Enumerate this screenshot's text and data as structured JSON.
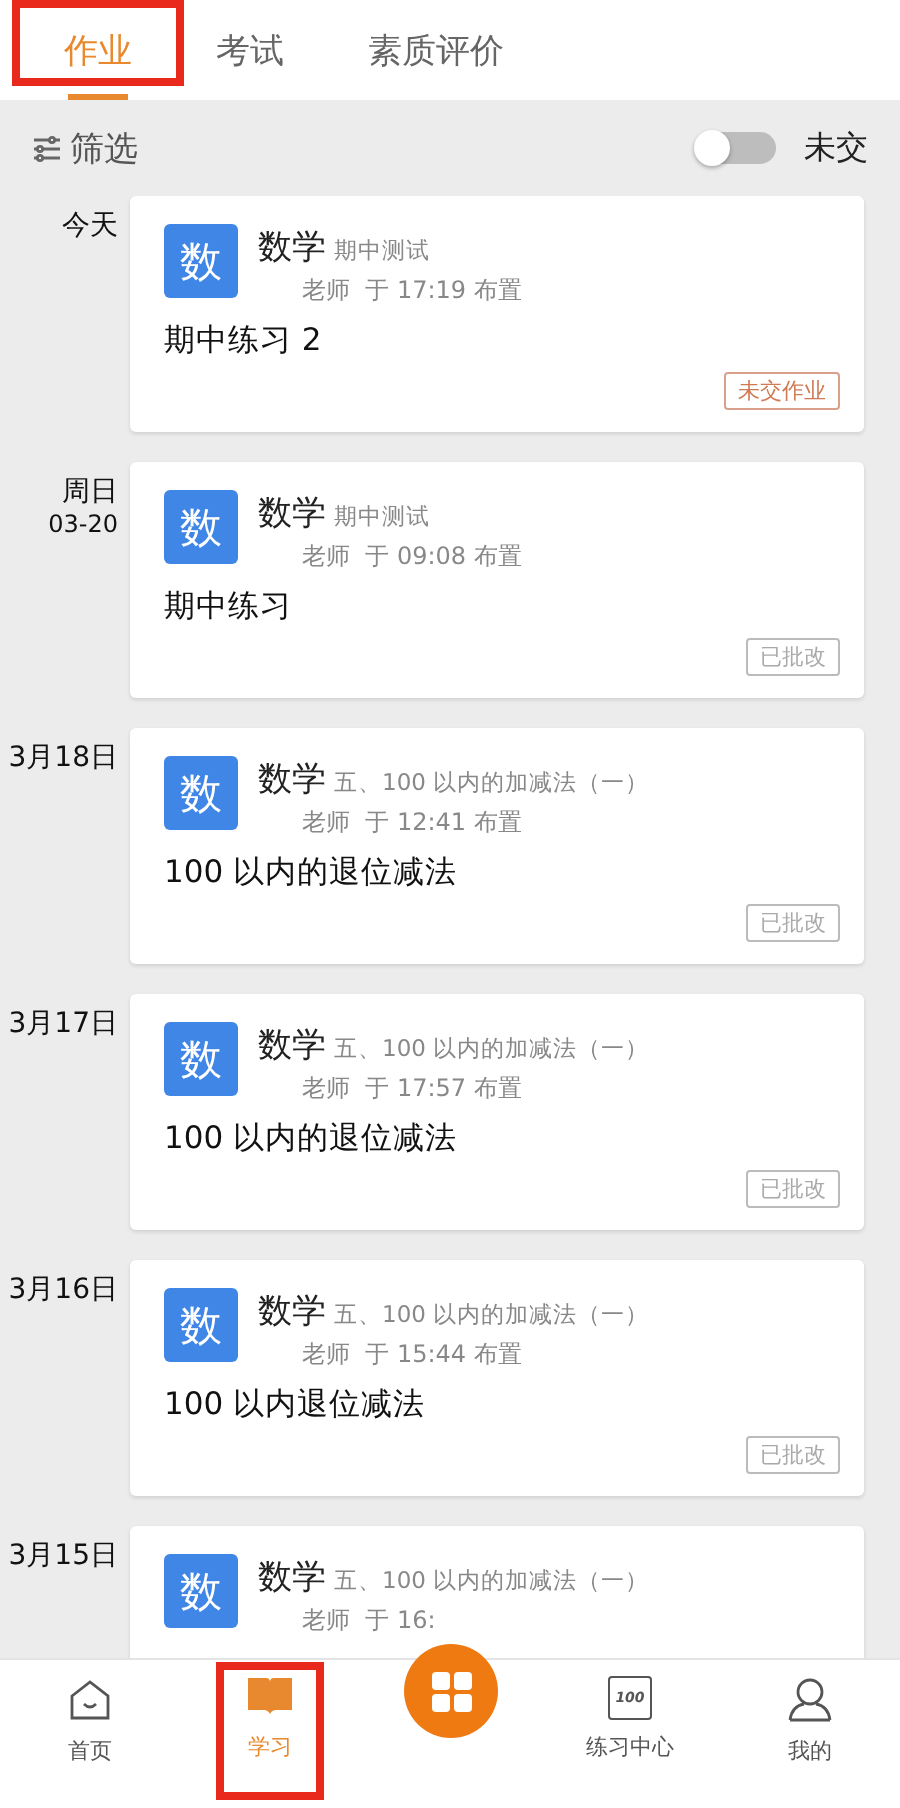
{
  "tabs": [
    {
      "label": "作业",
      "selected": true,
      "highlighted": true
    },
    {
      "label": "考试",
      "selected": false,
      "highlighted": false
    },
    {
      "label": "素质评价",
      "selected": false,
      "highlighted": false
    }
  ],
  "filter": {
    "label": "筛选",
    "toggle_label": "未交",
    "on": false
  },
  "assignments": [
    {
      "date": "今天",
      "subject_icon": "数",
      "subject": "数学",
      "unit": "期中测试",
      "meta": "老师  于 17:19 布置",
      "title": "期中练习 2",
      "status": {
        "kind": "pending",
        "label": "未交作业"
      }
    },
    {
      "date": "周日",
      "date_sub": "03-20",
      "subject_icon": "数",
      "subject": "数学",
      "unit": "期中测试",
      "meta": "老师  于 09:08 布置",
      "title": "期中练习",
      "status": {
        "kind": "reviewed",
        "label": "已批改"
      }
    },
    {
      "date": "3月18日",
      "subject_icon": "数",
      "subject": "数学",
      "unit": "五、100 以内的加减法（一）",
      "meta": "老师  于 12:41 布置",
      "title": "100 以内的退位减法",
      "status": {
        "kind": "reviewed",
        "label": "已批改"
      }
    },
    {
      "date": "3月17日",
      "subject_icon": "数",
      "subject": "数学",
      "unit": "五、100 以内的加减法（一）",
      "meta": "老师  于 17:57 布置",
      "title": "100 以内的退位减法",
      "status": {
        "kind": "reviewed",
        "label": "已批改"
      }
    },
    {
      "date": "3月16日",
      "subject_icon": "数",
      "subject": "数学",
      "unit": "五、100 以内的加减法（一）",
      "meta": "老师  于 15:44 布置",
      "title": "100 以内退位减法",
      "status": {
        "kind": "reviewed",
        "label": "已批改"
      }
    },
    {
      "date": "3月15日",
      "subject_icon": "数",
      "subject": "数学",
      "unit": "五、100 以内的加减法（一）",
      "meta": "老师  于 16:"
    }
  ],
  "nav": [
    {
      "kind": "home",
      "label": "首页",
      "selected": false,
      "highlighted": false
    },
    {
      "kind": "book",
      "label": "学习",
      "selected": true,
      "highlighted": true
    },
    {
      "kind": "center"
    },
    {
      "kind": "score",
      "label": "练习中心",
      "icon_text": "100",
      "selected": false,
      "highlighted": false
    },
    {
      "kind": "user",
      "label": "我的",
      "selected": false,
      "highlighted": false
    }
  ]
}
